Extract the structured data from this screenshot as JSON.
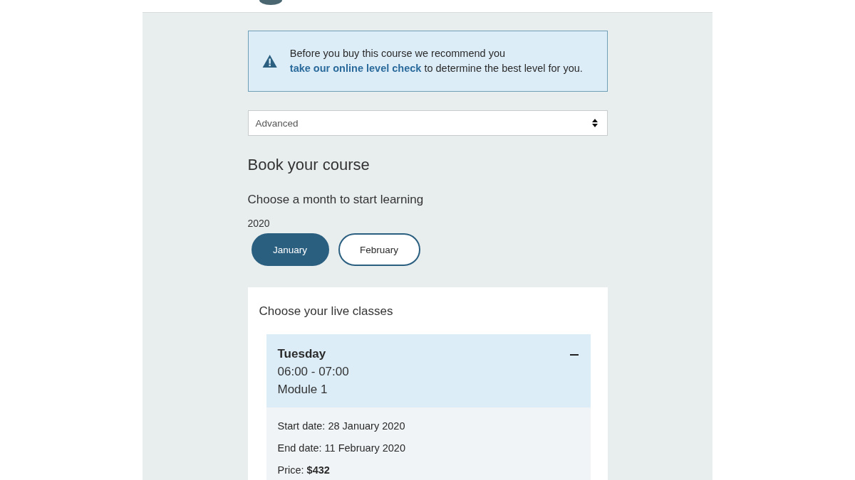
{
  "alert": {
    "text_before": "Before you buy this course we recommend you",
    "link": "take our online level check",
    "text_after": "to determine the best level for you."
  },
  "level_select": {
    "value": "Advanced"
  },
  "heading": "Book your course",
  "month_prompt": "Choose a month to start learning",
  "year": "2020",
  "months": [
    {
      "label": "January",
      "selected": true
    },
    {
      "label": "February",
      "selected": false
    }
  ],
  "classes": {
    "title": "Choose your live classes",
    "items": [
      {
        "day": "Tuesday",
        "time": "06:00 - 07:00",
        "module": "Module 1",
        "expanded": true,
        "details": [
          "Start date: 28 January 2020",
          "End date: 11 February 2020",
          "Price: **$432**"
        ]
      }
    ]
  }
}
